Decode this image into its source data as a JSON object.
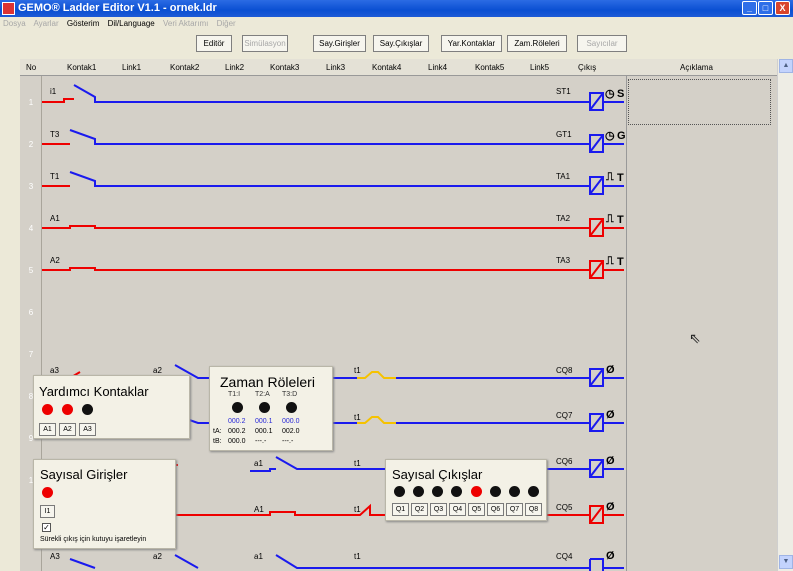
{
  "window": {
    "title": "GEMO® Ladder Editor V1.1 - ornek.ldr",
    "min": "_",
    "max": "□",
    "close": "X"
  },
  "menu": [
    {
      "label": "Dosya",
      "enabled": false
    },
    {
      "label": "Ayarlar",
      "enabled": false
    },
    {
      "label": "Gösterim",
      "enabled": true
    },
    {
      "label": "Dil/Language",
      "enabled": true
    },
    {
      "label": "Veri Aktarımı",
      "enabled": false
    },
    {
      "label": "Diğer",
      "enabled": false
    }
  ],
  "toolbar": {
    "editor": "Editör",
    "simulation": "Simülasyon",
    "sayGirisler": "Say.Girişler",
    "sayCikislar": "Say.Çıkışlar",
    "yarKontaklar": "Yar.Kontaklar",
    "zamRoleleri": "Zam.Röleleri",
    "sayicilar": "Sayıcılar"
  },
  "columns": {
    "no": "No",
    "k1": "Kontak1",
    "l1": "Link1",
    "k2": "Kontak2",
    "l2": "Link2",
    "k3": "Kontak3",
    "l3": "Link3",
    "k4": "Kontak4",
    "l4": "Link4",
    "k5": "Kontak5",
    "l5": "Link5",
    "out": "Çıkış",
    "desc": "Açıklama"
  },
  "rows": [
    "1",
    "2",
    "3",
    "4",
    "5",
    "6",
    "7",
    "8",
    "9",
    "1"
  ],
  "rungs": {
    "r1": {
      "contact": "i1",
      "coil": "ST1",
      "type": "S"
    },
    "r2": {
      "contact": "T3",
      "coil": "GT1",
      "type": "G"
    },
    "r3": {
      "contact": "T1",
      "coil": "TA1",
      "type": "T"
    },
    "r4": {
      "contact": "A1",
      "coil": "TA2",
      "type": "T"
    },
    "r5": {
      "contact": "A2",
      "coil": "TA3",
      "type": "T"
    },
    "r7": {
      "c1": "a3",
      "c2": "a2",
      "c4": "t1",
      "coil": "CQ8"
    },
    "r8": {
      "c4": "t1",
      "coil": "CQ7"
    },
    "r9": {
      "c3": "a1",
      "c4": "t1",
      "coil": "CQ6"
    },
    "r10": {
      "c3": "A1",
      "c4": "t1",
      "coil": "CQ5"
    },
    "r11": {
      "c1": "A3",
      "c2": "a2",
      "c3": "a1",
      "c4": "t1",
      "coil": "CQ4"
    }
  },
  "panels": {
    "yardimci": {
      "title": "Yardımcı Kontaklar",
      "buttons": [
        "A1",
        "A2",
        "A3"
      ]
    },
    "zaman": {
      "title": "Zaman Röleleri",
      "cols": [
        "T1:I",
        "T2:A",
        "T3:D"
      ],
      "row0": [
        "000.2",
        "000.1",
        "000.0"
      ],
      "rowA_label": "tA:",
      "rowA": [
        "000.2",
        "000.1",
        "002.0"
      ],
      "rowB_label": "tB:",
      "rowB": [
        "000.0",
        "---.-",
        "---.-"
      ]
    },
    "girisler": {
      "title": "Sayısal Girişler",
      "button": "I1",
      "checkbox_label": "Sürekli çıkış için kutuyu işaretleyin"
    },
    "cikislar": {
      "title": "Sayısal Çıkışlar",
      "buttons": [
        "Q1",
        "Q2",
        "Q3",
        "Q4",
        "Q5",
        "Q6",
        "Q7",
        "Q8"
      ],
      "active_index": 4
    }
  },
  "colors": {
    "red": "#ee0000",
    "blue": "#1a1aee",
    "orange": "#f5c200",
    "dark": "#111111"
  }
}
